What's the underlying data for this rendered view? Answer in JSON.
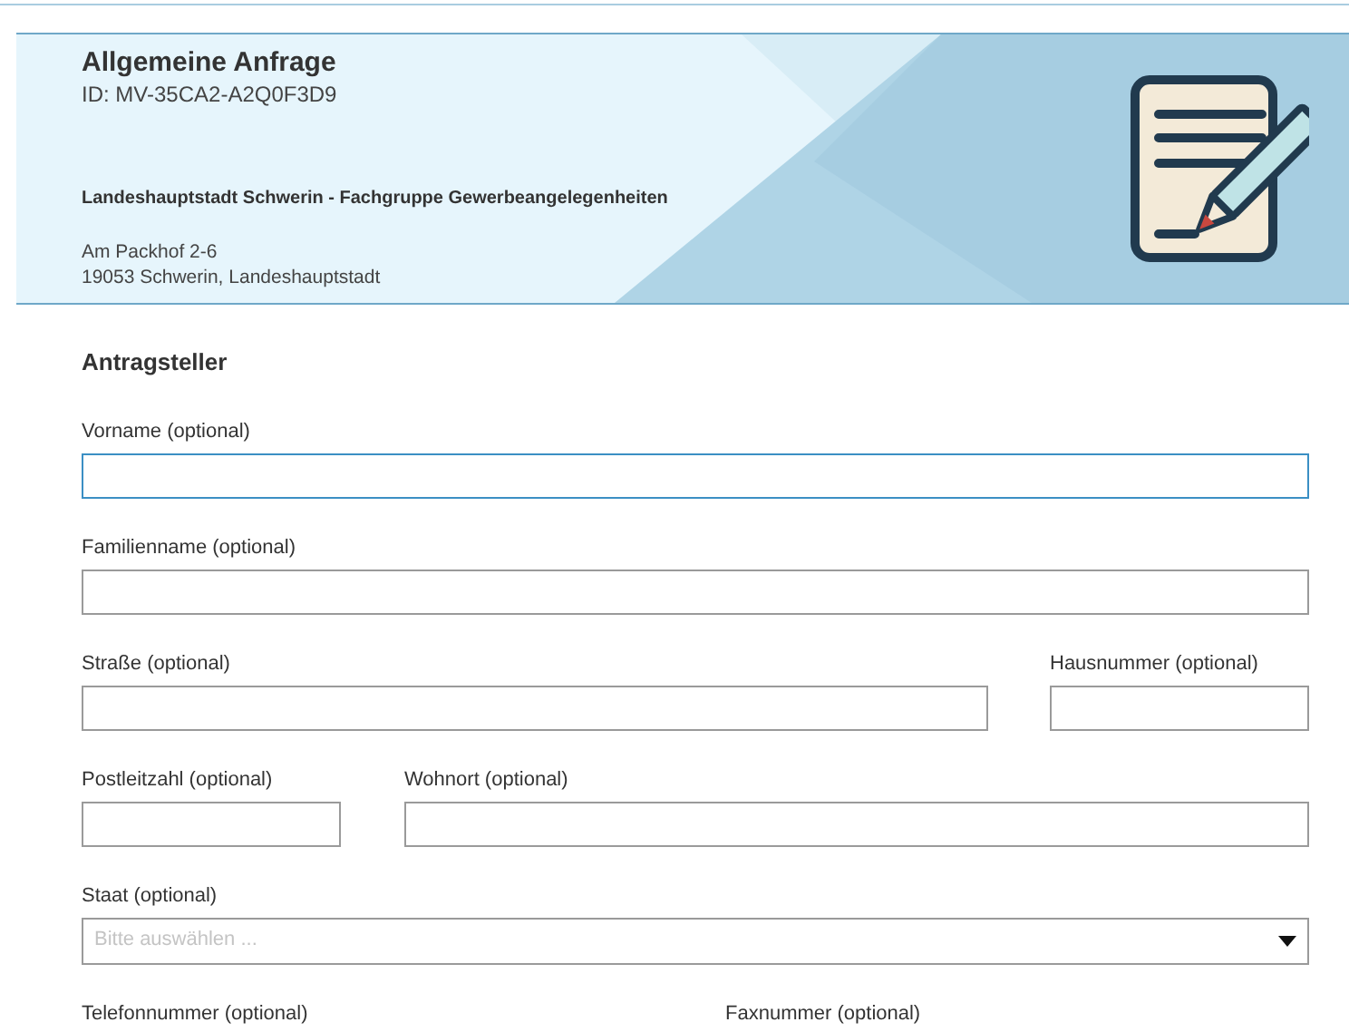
{
  "header": {
    "title": "Allgemeine Anfrage",
    "id": "ID: MV-35CA2-A2Q0F3D9",
    "authority": "Landeshauptstadt Schwerin - Fachgruppe Gewerbeangelegenheiten",
    "address": [
      "Am Packhof 2-6",
      "19053 Schwerin, Landeshauptstadt"
    ]
  },
  "section": "Antragsteller",
  "rows": [
    {
      "kind": "single",
      "fields": [
        {
          "label": "Vorname (optional)",
          "kind": "text",
          "focused": true
        }
      ]
    },
    {
      "kind": "single",
      "fields": [
        {
          "label": "Familienname (optional)",
          "kind": "text",
          "focused": false
        }
      ]
    },
    {
      "kind": "wide-narrow",
      "fields": [
        {
          "label": "Straße (optional)",
          "kind": "text",
          "focused": false
        },
        {
          "label": "Hausnummer (optional)",
          "kind": "text",
          "focused": false
        }
      ]
    },
    {
      "kind": "narrow-wide",
      "fields": [
        {
          "label": "Postleitzahl (optional)",
          "kind": "text",
          "focused": false
        },
        {
          "label": "Wohnort (optional)",
          "kind": "text",
          "focused": false
        }
      ]
    },
    {
      "kind": "single",
      "fields": [
        {
          "label": "Staat (optional)",
          "kind": "select",
          "focused": false,
          "placeholder": "Bitte auswählen ..."
        }
      ]
    },
    {
      "kind": "pair",
      "fields": [
        {
          "label": "Telefonnummer (optional)"
        },
        {
          "label": "Faxnummer (optional)"
        }
      ]
    }
  ]
}
